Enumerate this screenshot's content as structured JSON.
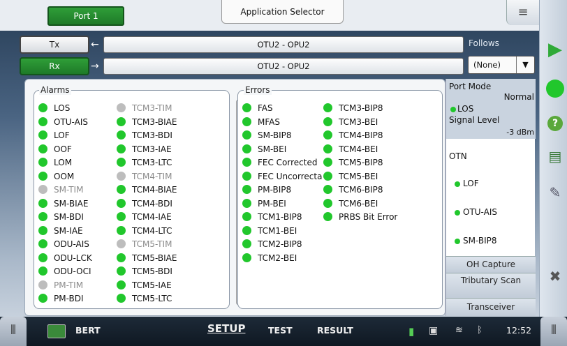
{
  "header": {
    "port_tab": "Port 1",
    "app_selector": "Application Selector",
    "menu_icon": "≡"
  },
  "tx": {
    "label": "Tx",
    "path": "OTU2 - OPU2"
  },
  "rx": {
    "label": "Rx",
    "path": "OTU2 - OPU2"
  },
  "follows": {
    "label": "Follows",
    "value": "(None)"
  },
  "alarms": {
    "title": "Alarms",
    "col1": [
      {
        "label": "LOS",
        "on": true
      },
      {
        "label": "OTU-AIS",
        "on": true
      },
      {
        "label": "LOF",
        "on": true
      },
      {
        "label": "OOF",
        "on": true
      },
      {
        "label": "LOM",
        "on": true
      },
      {
        "label": "OOM",
        "on": true
      },
      {
        "label": "SM-TIM",
        "on": false
      },
      {
        "label": "SM-BIAE",
        "on": true
      },
      {
        "label": "SM-BDI",
        "on": true
      },
      {
        "label": "SM-IAE",
        "on": true
      },
      {
        "label": "ODU-AIS",
        "on": true
      },
      {
        "label": "ODU-LCK",
        "on": true
      },
      {
        "label": "ODU-OCI",
        "on": true
      },
      {
        "label": "PM-TIM",
        "on": false
      },
      {
        "label": "PM-BDI",
        "on": true
      }
    ],
    "col2": [
      {
        "label": "TCM3-TIM",
        "on": false
      },
      {
        "label": "TCM3-BIAE",
        "on": true
      },
      {
        "label": "TCM3-BDI",
        "on": true
      },
      {
        "label": "TCM3-IAE",
        "on": true
      },
      {
        "label": "TCM3-LTC",
        "on": true
      },
      {
        "label": "TCM4-TIM",
        "on": false
      },
      {
        "label": "TCM4-BIAE",
        "on": true
      },
      {
        "label": "TCM4-BDI",
        "on": true
      },
      {
        "label": "TCM4-IAE",
        "on": true
      },
      {
        "label": "TCM4-LTC",
        "on": true
      },
      {
        "label": "TCM5-TIM",
        "on": false
      },
      {
        "label": "TCM5-BIAE",
        "on": true
      },
      {
        "label": "TCM5-BDI",
        "on": true
      },
      {
        "label": "TCM5-IAE",
        "on": true
      },
      {
        "label": "TCM5-LTC",
        "on": true
      }
    ]
  },
  "errors": {
    "title": "Errors",
    "col1": [
      "FAS",
      "MFAS",
      "SM-BIP8",
      "SM-BEI",
      "FEC Corrected",
      "FEC Uncorrecta",
      "PM-BIP8",
      "PM-BEI",
      "TCM1-BIP8",
      "TCM1-BEI",
      "TCM2-BIP8",
      "TCM2-BEI"
    ],
    "col2": [
      "TCM3-BIP8",
      "TCM3-BEI",
      "TCM4-BIP8",
      "TCM4-BEI",
      "TCM5-BIP8",
      "TCM5-BEI",
      "TCM6-BIP8",
      "TCM6-BEI",
      "PRBS Bit Error"
    ]
  },
  "side_panel": {
    "port_mode_label": "Port Mode",
    "port_mode_value": "Normal",
    "los": "LOS",
    "signal_level_label": "Signal Level",
    "signal_level_value": "-3 dBm",
    "otn_label": "OTN",
    "otn_items": [
      "LOF",
      "OTU-AIS",
      "SM-BIP8"
    ],
    "buttons": [
      "OH Capture",
      "Tributary Scan",
      "Transceiver"
    ]
  },
  "bottom": {
    "app_name": "BERT",
    "tabs": [
      "SETUP",
      "TEST",
      "RESULT"
    ],
    "time": "12:52"
  },
  "colors": {
    "green_on": "#21c72c",
    "gray_off": "#bdbdbd",
    "accent_green": "#2f9e38"
  }
}
